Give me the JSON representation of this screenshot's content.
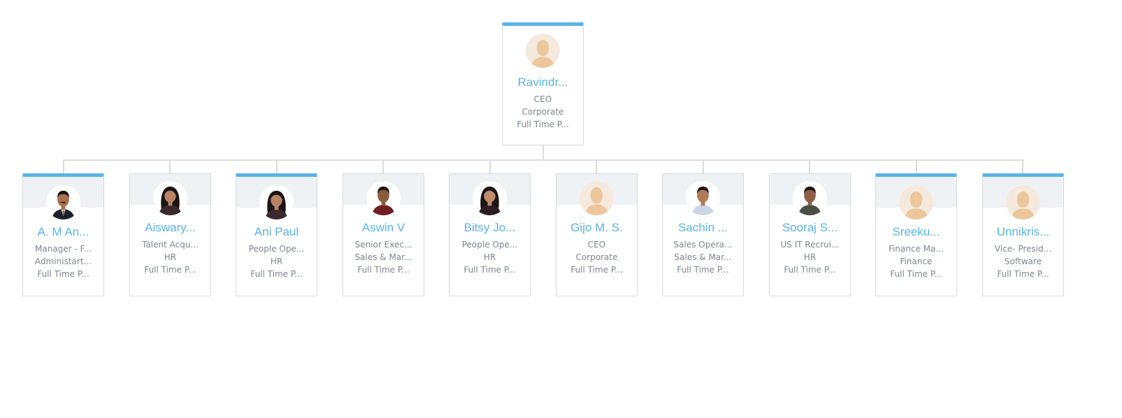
{
  "org_chart": {
    "root": {
      "name": "Ravindr...",
      "designation": "CEO",
      "department": "Corporate",
      "employment_type": "Full Time P...",
      "photo": "default-avatar",
      "highlight": true
    },
    "children": [
      {
        "name": "A. M An...",
        "designation": "Manager - F...",
        "department": "Administart...",
        "employment_type": "Full Time P...",
        "photo": "man-suit-mustache",
        "highlight": true
      },
      {
        "name": "Aiswary...",
        "designation": "Talent Acqu...",
        "department": "HR",
        "employment_type": "Full Time P...",
        "photo": "woman-dark-hair",
        "highlight": false
      },
      {
        "name": "Ani Paul",
        "designation": "People Ope...",
        "department": "HR",
        "employment_type": "Full Time P...",
        "photo": "woman-dark-hair",
        "highlight": true
      },
      {
        "name": "Aswin V",
        "designation": "Senior Exec...",
        "department": "Sales & Mar...",
        "employment_type": "Full Time P...",
        "photo": "man-maroon-shirt",
        "highlight": false
      },
      {
        "name": "Bitsy Jo...",
        "designation": "People Ope...",
        "department": "HR",
        "employment_type": "Full Time P...",
        "photo": "woman-long-hair",
        "highlight": false
      },
      {
        "name": "Gijo M. S.",
        "designation": "CEO",
        "department": "Corporate",
        "employment_type": "Full Time P...",
        "photo": "default-avatar",
        "highlight": false
      },
      {
        "name": "Sachin ...",
        "designation": "Sales Opera...",
        "department": "Sales & Mar...",
        "employment_type": "Full Time P...",
        "photo": "man-light-shirt",
        "highlight": false
      },
      {
        "name": "Sooraj S...",
        "designation": "US IT Recrui...",
        "department": "HR",
        "employment_type": "Full Time P...",
        "photo": "man-checked-shirt",
        "highlight": false
      },
      {
        "name": "Sreeku...",
        "designation": "Finance Ma...",
        "department": "Finance",
        "employment_type": "Full Time P...",
        "photo": "default-avatar",
        "highlight": true
      },
      {
        "name": "Unnikris...",
        "designation": "Vice- Presid...",
        "department": "Software",
        "employment_type": "Full Time P...",
        "photo": "default-avatar",
        "highlight": true
      }
    ]
  },
  "colors": {
    "accent": "#5ab3e8",
    "name_text": "#5ab3e8",
    "info_text": "#7d858d",
    "connector": "#d9dcdf",
    "card_border": "#d5d8dc",
    "card_head": "#eef2f4"
  }
}
